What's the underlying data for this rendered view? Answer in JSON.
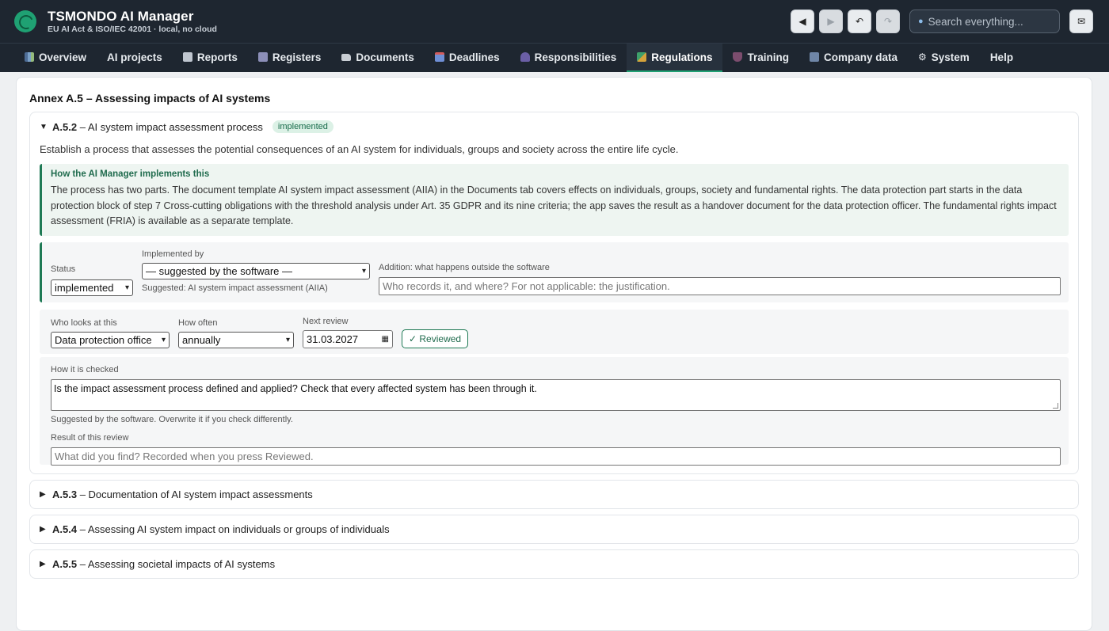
{
  "app": {
    "title": "TSMONDO AI Manager",
    "subtitle": "EU AI Act & ISO/IEC 42001 · local, no cloud"
  },
  "header": {
    "back": "◀",
    "forward": "▶",
    "undo": "↶",
    "redo": "↷",
    "search_placeholder": "Search everything...",
    "mail": "✉"
  },
  "nav": [
    {
      "label": "Overview",
      "icon": "chart-icon"
    },
    {
      "label": "AI projects",
      "icon": ""
    },
    {
      "label": "Reports",
      "icon": "document-icon"
    },
    {
      "label": "Registers",
      "icon": "register-icon"
    },
    {
      "label": "Documents",
      "icon": "folder-icon"
    },
    {
      "label": "Deadlines",
      "icon": "calendar-icon"
    },
    {
      "label": "Responsibilities",
      "icon": "people-icon"
    },
    {
      "label": "Regulations",
      "icon": "regulations-icon",
      "active": true
    },
    {
      "label": "Training",
      "icon": "training-icon"
    },
    {
      "label": "Company data",
      "icon": "building-icon"
    },
    {
      "label": "System",
      "icon": "gear-icon"
    },
    {
      "label": "Help",
      "icon": ""
    }
  ],
  "section": {
    "title": "Annex A.5 – Assessing impacts of AI systems"
  },
  "control": {
    "id": "A.5.2",
    "title": "– AI system impact assessment process",
    "badge": "implemented",
    "description": "Establish a process that assesses the potential consequences of an AI system for individuals, groups and society across the entire life cycle.",
    "impl_title": "How the AI Manager implements this",
    "impl_text": "The process has two parts. The document template AI system impact assessment (AIIA) in the Documents tab covers effects on individuals, groups, society and fundamental rights. The data protection part starts in the data protection block of step 7 Cross-cutting obligations with the threshold analysis under Art. 35 GDPR and its nine criteria; the app saves the result as a handover document for the data protection officer. The fundamental rights impact assessment (FRIA) is available as a separate template.",
    "status_label": "Status",
    "status_value": "implemented",
    "implby_label": "Implemented by",
    "implby_value": "— suggested by the software —",
    "implby_hint": "Suggested: AI system impact assessment (AIIA)",
    "addition_label": "Addition: what happens outside the software",
    "addition_placeholder": "Who records it, and where? For not applicable: the justification.",
    "who_label": "Who looks at this",
    "who_value": "Data protection office",
    "often_label": "How often",
    "often_value": "annually",
    "next_label": "Next review",
    "next_value": "31.03.2027",
    "reviewed_btn": "✓ Reviewed",
    "check_label": "How it is checked",
    "check_value": "Is the impact assessment process defined and applied? Check that every affected system has been through it.",
    "check_hint": "Suggested by the software. Overwrite it if you check differently.",
    "result_label": "Result of this review",
    "result_placeholder": "What did you find? Recorded when you press Reviewed."
  },
  "collapsed": [
    {
      "id": "A.5.3",
      "title": "– Documentation of AI system impact assessments"
    },
    {
      "id": "A.5.4",
      "title": "– Assessing AI system impact on individuals or groups of individuals"
    },
    {
      "id": "A.5.5",
      "title": "– Assessing societal impacts of AI systems"
    }
  ]
}
